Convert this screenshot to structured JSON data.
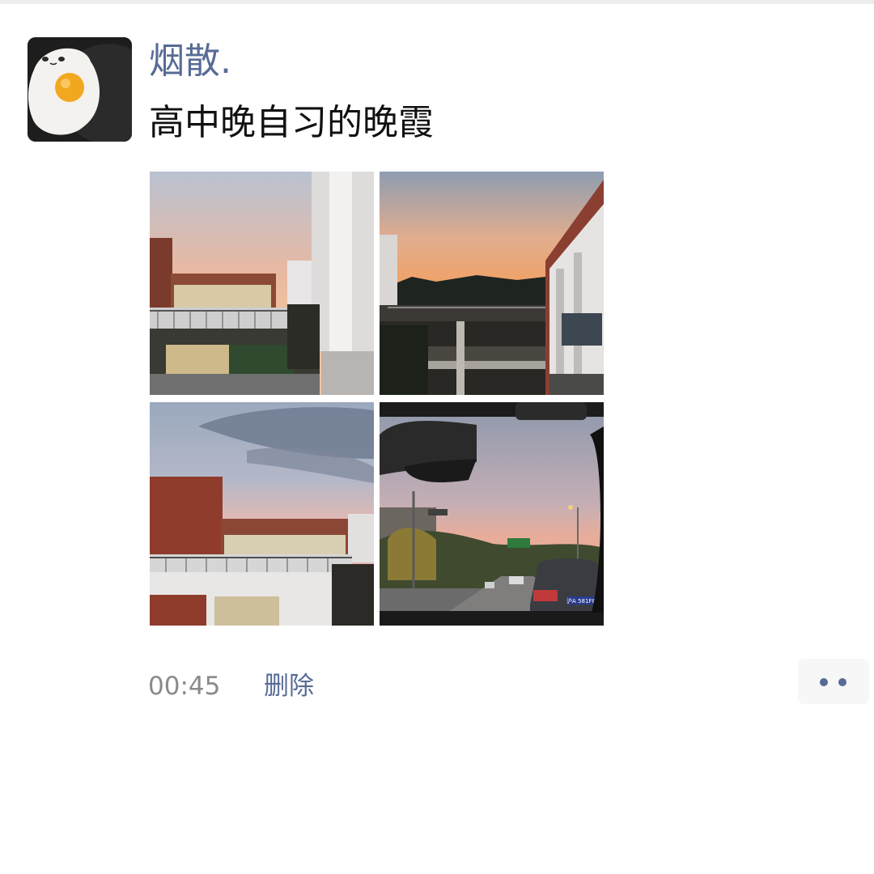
{
  "post": {
    "author": "烟散.",
    "text": "高中晚自习的晚霞",
    "time": "00:45",
    "delete_label": "删除"
  },
  "avatar": {
    "icon": "fried-egg-avatar"
  },
  "photos": [
    {
      "name": "photo-sunset-school-balcony-1"
    },
    {
      "name": "photo-sunset-school-corridor"
    },
    {
      "name": "photo-sunset-school-balcony-2"
    },
    {
      "name": "photo-sunset-road-from-car",
      "plate_text": "沪A 581F8"
    }
  ],
  "more_button": {
    "icon": "more-dots-icon"
  },
  "colors": {
    "link_blue": "#576b95",
    "text_dark": "#111111",
    "time_gray": "#8a8a8a",
    "more_button_bg": "#f7f7f7"
  }
}
